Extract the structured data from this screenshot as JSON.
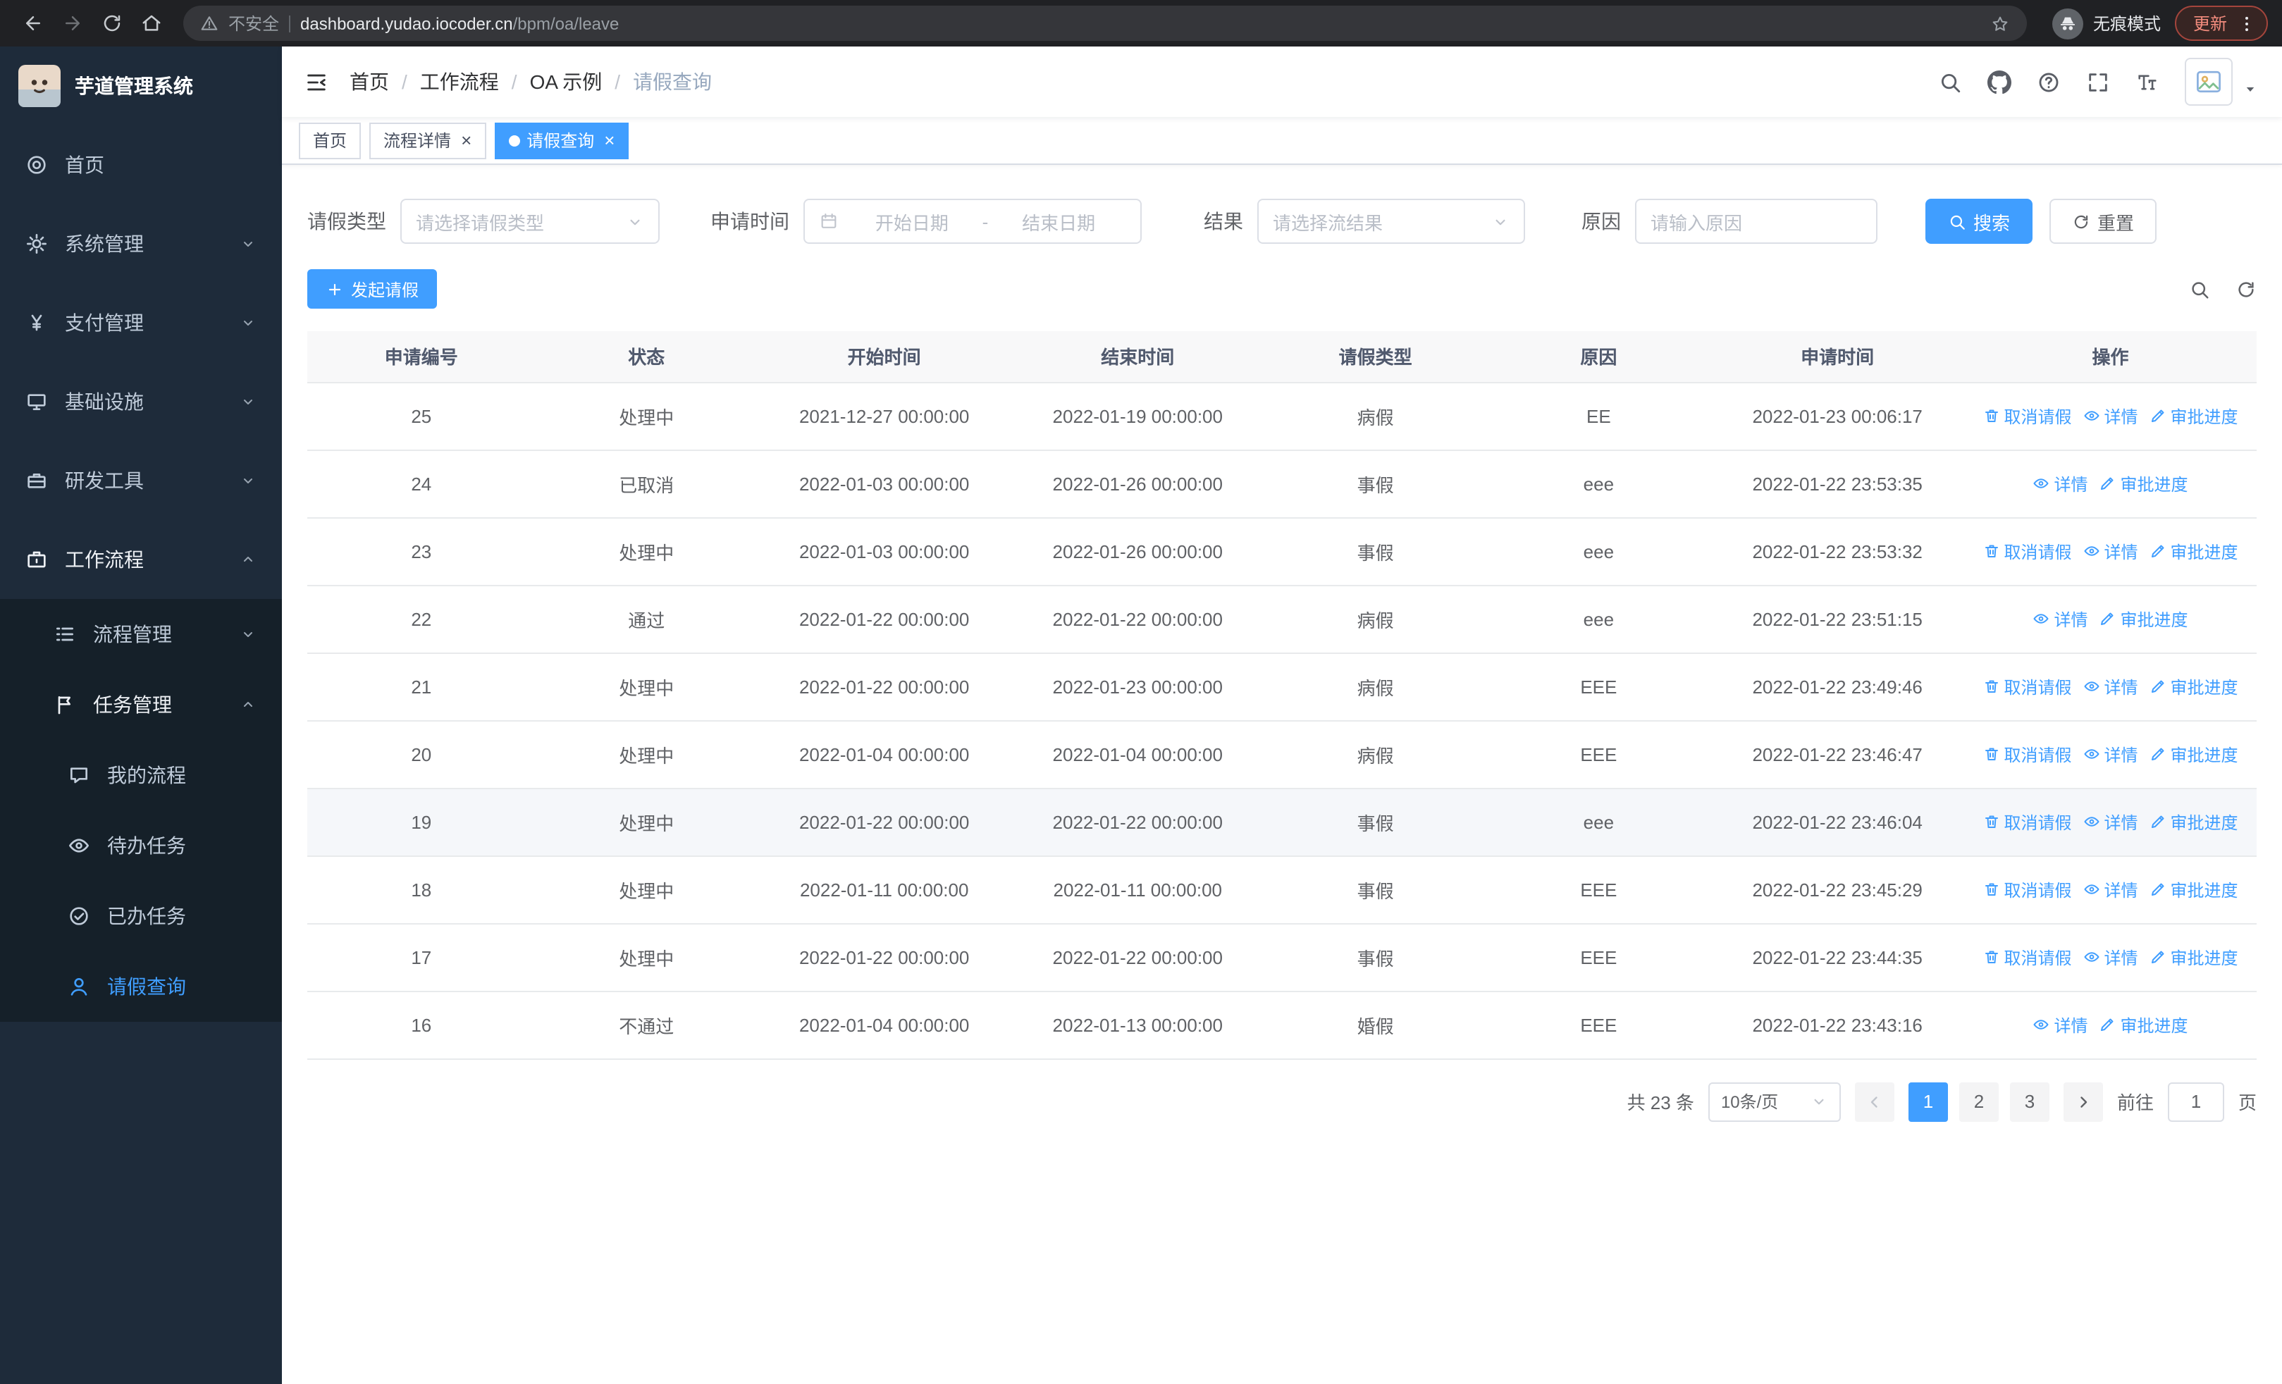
{
  "browser": {
    "security_label": "不安全",
    "url_domain": "dashboard.yudao.iocoder.cn",
    "url_path": "/bpm/oa/leave",
    "incognito_label": "无痕模式",
    "update_label": "更新"
  },
  "sidebar": {
    "app_title": "芋道管理系统",
    "items": [
      {
        "label": "首页",
        "icon": "home-icon",
        "level": 0
      },
      {
        "label": "系统管理",
        "icon": "gear-icon",
        "level": 0,
        "arrow": "down"
      },
      {
        "label": "支付管理",
        "icon": "yen-icon",
        "level": 0,
        "arrow": "down"
      },
      {
        "label": "基础设施",
        "icon": "infra-icon",
        "level": 0,
        "arrow": "down"
      },
      {
        "label": "研发工具",
        "icon": "tools-icon",
        "level": 0,
        "arrow": "down"
      },
      {
        "label": "工作流程",
        "icon": "workflow-icon",
        "level": 0,
        "arrow": "up",
        "expanded": true
      },
      {
        "label": "流程管理",
        "icon": "process-icon",
        "level": 1,
        "arrow": "down"
      },
      {
        "label": "任务管理",
        "icon": "task-icon",
        "level": 1,
        "arrow": "up",
        "expanded": true
      },
      {
        "label": "我的流程",
        "icon": "chat-icon",
        "level": 2
      },
      {
        "label": "待办任务",
        "icon": "eye-icon",
        "level": 2
      },
      {
        "label": "已办任务",
        "icon": "done-icon",
        "level": 2
      },
      {
        "label": "请假查询",
        "icon": "user-icon",
        "level": 2,
        "active": true
      }
    ]
  },
  "breadcrumb": [
    "首页",
    "工作流程",
    "OA 示例",
    "请假查询"
  ],
  "tabs": [
    {
      "label": "首页",
      "closable": false,
      "active": false
    },
    {
      "label": "流程详情",
      "closable": true,
      "active": false
    },
    {
      "label": "请假查询",
      "closable": true,
      "active": true
    }
  ],
  "filters": {
    "leave_type_label": "请假类型",
    "leave_type_placeholder": "请选择请假类型",
    "apply_time_label": "申请时间",
    "start_placeholder": "开始日期",
    "range_separator": "-",
    "end_placeholder": "结束日期",
    "result_label": "结果",
    "result_placeholder": "请选择流结果",
    "reason_label": "原因",
    "reason_placeholder": "请输入原因",
    "search_label": "搜索",
    "reset_label": "重置"
  },
  "toolbar": {
    "create_label": "发起请假"
  },
  "table": {
    "headers": [
      "申请编号",
      "状态",
      "开始时间",
      "结束时间",
      "请假类型",
      "原因",
      "申请时间",
      "操作"
    ],
    "action_labels": {
      "cancel": "取消请假",
      "detail": "详情",
      "progress": "审批进度"
    },
    "rows": [
      {
        "id": "25",
        "status": "处理中",
        "start_time": "2021-12-27 00:00:00",
        "end_time": "2022-01-19 00:00:00",
        "leave_type": "病假",
        "reason": "EE",
        "apply_time": "2022-01-23 00:06:17",
        "actions": [
          "cancel",
          "detail",
          "progress"
        ]
      },
      {
        "id": "24",
        "status": "已取消",
        "start_time": "2022-01-03 00:00:00",
        "end_time": "2022-01-26 00:00:00",
        "leave_type": "事假",
        "reason": "eee",
        "apply_time": "2022-01-22 23:53:35",
        "actions": [
          "detail",
          "progress"
        ]
      },
      {
        "id": "23",
        "status": "处理中",
        "start_time": "2022-01-03 00:00:00",
        "end_time": "2022-01-26 00:00:00",
        "leave_type": "事假",
        "reason": "eee",
        "apply_time": "2022-01-22 23:53:32",
        "actions": [
          "cancel",
          "detail",
          "progress"
        ]
      },
      {
        "id": "22",
        "status": "通过",
        "start_time": "2022-01-22 00:00:00",
        "end_time": "2022-01-22 00:00:00",
        "leave_type": "病假",
        "reason": "eee",
        "apply_time": "2022-01-22 23:51:15",
        "actions": [
          "detail",
          "progress"
        ]
      },
      {
        "id": "21",
        "status": "处理中",
        "start_time": "2022-01-22 00:00:00",
        "end_time": "2022-01-23 00:00:00",
        "leave_type": "病假",
        "reason": "EEE",
        "apply_time": "2022-01-22 23:49:46",
        "actions": [
          "cancel",
          "detail",
          "progress"
        ]
      },
      {
        "id": "20",
        "status": "处理中",
        "start_time": "2022-01-04 00:00:00",
        "end_time": "2022-01-04 00:00:00",
        "leave_type": "病假",
        "reason": "EEE",
        "apply_time": "2022-01-22 23:46:47",
        "actions": [
          "cancel",
          "detail",
          "progress"
        ]
      },
      {
        "id": "19",
        "status": "处理中",
        "start_time": "2022-01-22 00:00:00",
        "end_time": "2022-01-22 00:00:00",
        "leave_type": "事假",
        "reason": "eee",
        "apply_time": "2022-01-22 23:46:04",
        "actions": [
          "cancel",
          "detail",
          "progress"
        ],
        "highlighted": true
      },
      {
        "id": "18",
        "status": "处理中",
        "start_time": "2022-01-11 00:00:00",
        "end_time": "2022-01-11 00:00:00",
        "leave_type": "事假",
        "reason": "EEE",
        "apply_time": "2022-01-22 23:45:29",
        "actions": [
          "cancel",
          "detail",
          "progress"
        ]
      },
      {
        "id": "17",
        "status": "处理中",
        "start_time": "2022-01-22 00:00:00",
        "end_time": "2022-01-22 00:00:00",
        "leave_type": "事假",
        "reason": "EEE",
        "apply_time": "2022-01-22 23:44:35",
        "actions": [
          "cancel",
          "detail",
          "progress"
        ]
      },
      {
        "id": "16",
        "status": "不通过",
        "start_time": "2022-01-04 00:00:00",
        "end_time": "2022-01-13 00:00:00",
        "leave_type": "婚假",
        "reason": "EEE",
        "apply_time": "2022-01-22 23:43:16",
        "actions": [
          "detail",
          "progress"
        ]
      }
    ]
  },
  "pagination": {
    "total_label": "共 23 条",
    "page_size": "10条/页",
    "pages": [
      "1",
      "2",
      "3"
    ],
    "active_page": "1",
    "goto_label": "前往",
    "goto_value": "1",
    "goto_suffix": "页"
  },
  "colors": {
    "primary": "#409eff",
    "sidebar_bg": "#1e2b3a",
    "sidebar_submenu_bg": "#152029"
  }
}
